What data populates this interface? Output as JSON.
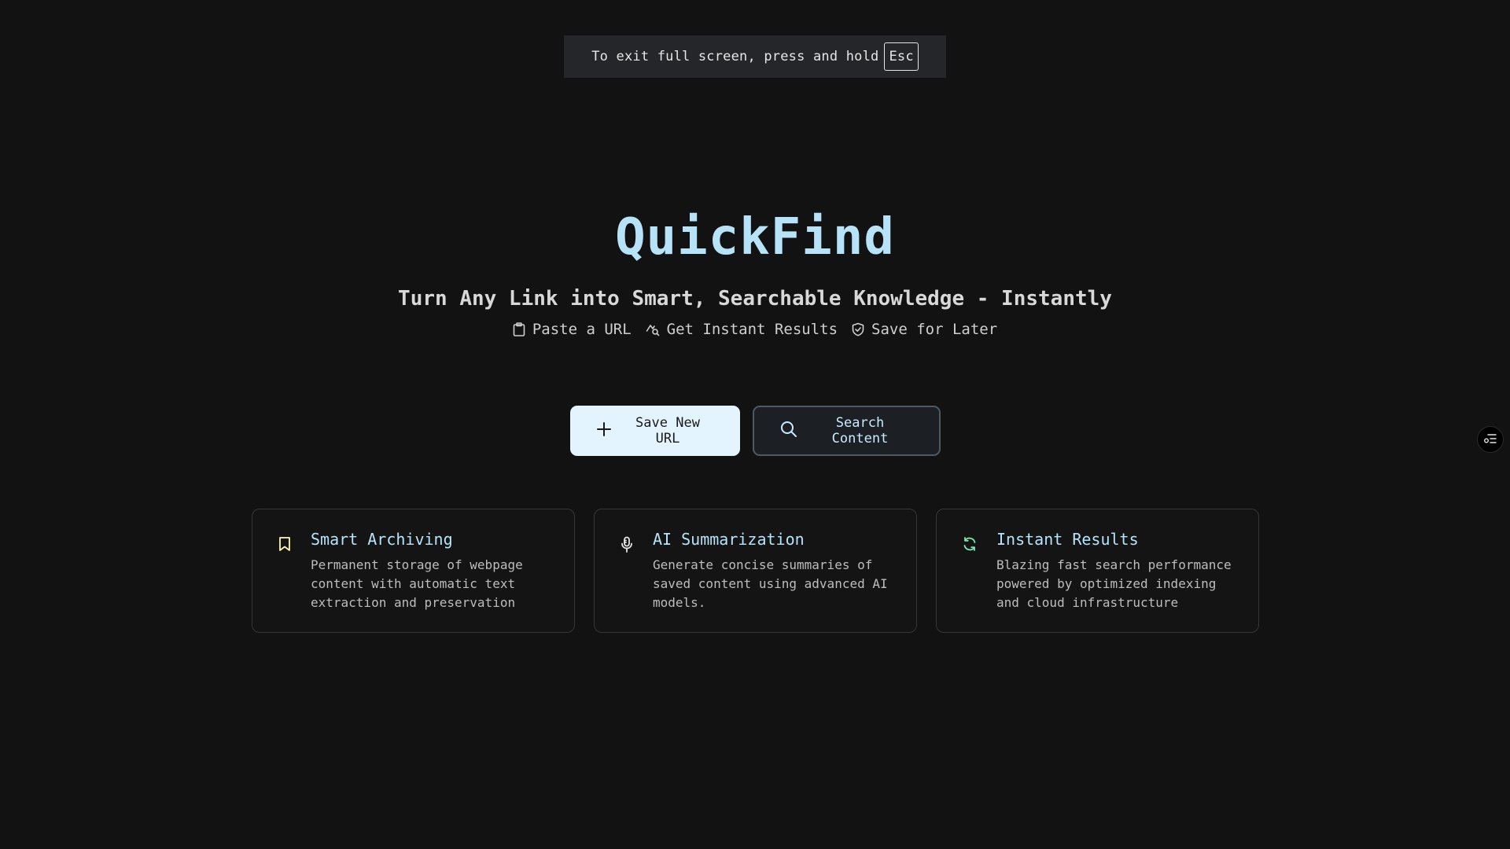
{
  "fullscreen_banner": {
    "message": "To exit full screen, press and hold",
    "key": "Esc"
  },
  "hero": {
    "title": "QuickFind",
    "subtitle": "Turn Any Link into Smart, Searchable Knowledge - Instantly",
    "features": [
      {
        "icon": "clipboard-icon",
        "label": "Paste a URL"
      },
      {
        "icon": "sparkle-search-icon",
        "label": "Get Instant Results"
      },
      {
        "icon": "shield-check-icon",
        "label": "Save for Later"
      }
    ]
  },
  "actions": {
    "save_url_label": "Save New URL",
    "search_label": "Search Content"
  },
  "cards": [
    {
      "icon": "bookmark-icon",
      "title": "Smart Archiving",
      "description": "Permanent storage of webpage content with automatic text extraction and preservation"
    },
    {
      "icon": "microphone-icon",
      "title": "AI Summarization",
      "description": "Generate concise summaries of saved content using advanced AI models."
    },
    {
      "icon": "refresh-icon",
      "title": "Instant Results",
      "description": "Blazing fast search performance powered by optimized indexing and cloud infrastructure"
    }
  ],
  "colors": {
    "background": "#121212",
    "accent": "#b7e3f8",
    "primary_button": "#e3f4ff",
    "bookmark_icon": "#fff7b0",
    "refresh_icon": "#7fe3b6"
  }
}
